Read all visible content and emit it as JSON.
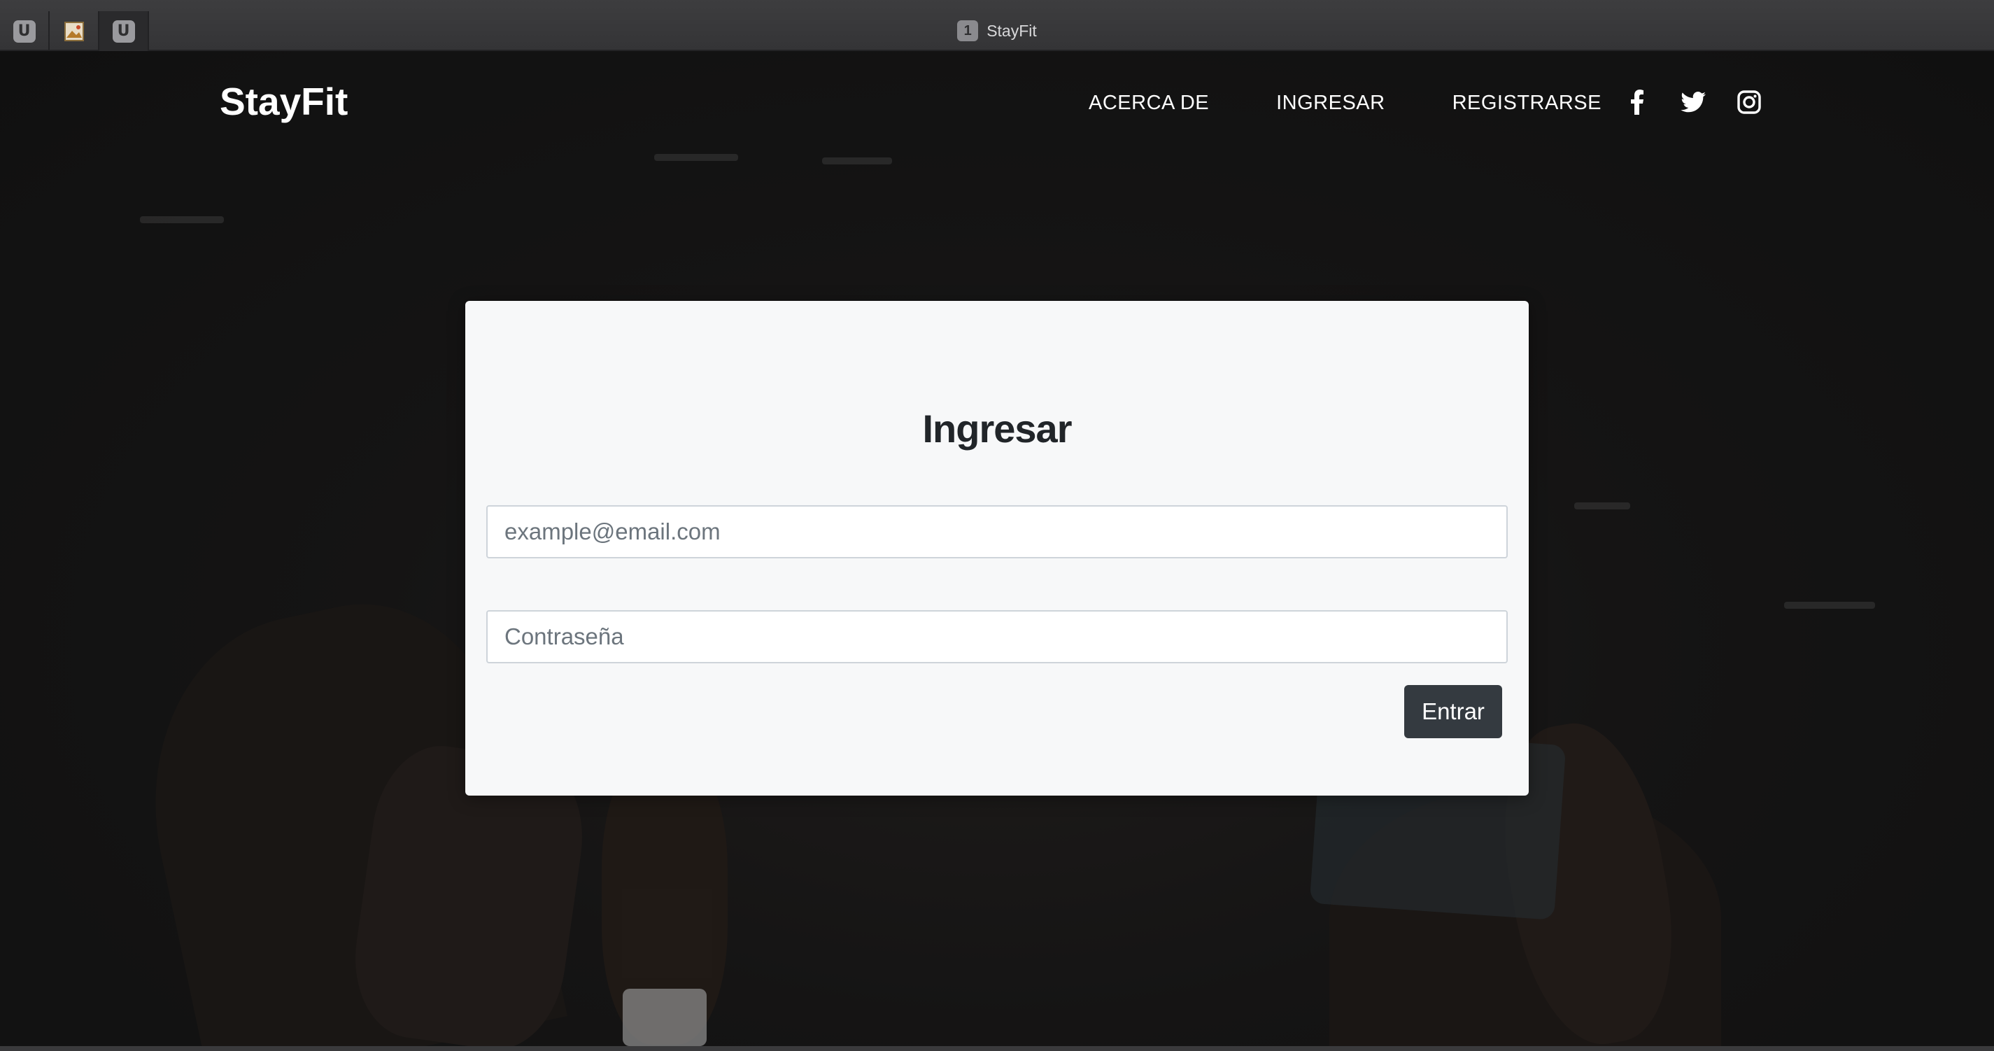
{
  "browser": {
    "tabs": [
      {
        "icon": "u-letter-icon",
        "label": "U"
      },
      {
        "icon": "image-favicon",
        "label": ""
      },
      {
        "icon": "u-letter-icon",
        "label": "U"
      }
    ],
    "window_title": "StayFit",
    "window_badge": "1"
  },
  "navbar": {
    "brand": "StayFit",
    "links": [
      "ACERCA DE",
      "INGRESAR",
      "REGISTRARSE"
    ],
    "social": [
      "facebook-icon",
      "twitter-icon",
      "instagram-icon"
    ]
  },
  "login": {
    "title": "Ingresar",
    "email_placeholder": "example@email.com",
    "password_placeholder": "Contraseña",
    "submit_label": "Entrar"
  },
  "colors": {
    "card_bg": "#f7f8f9",
    "button_bg": "#343a40",
    "nav_text": "#ffffff"
  }
}
